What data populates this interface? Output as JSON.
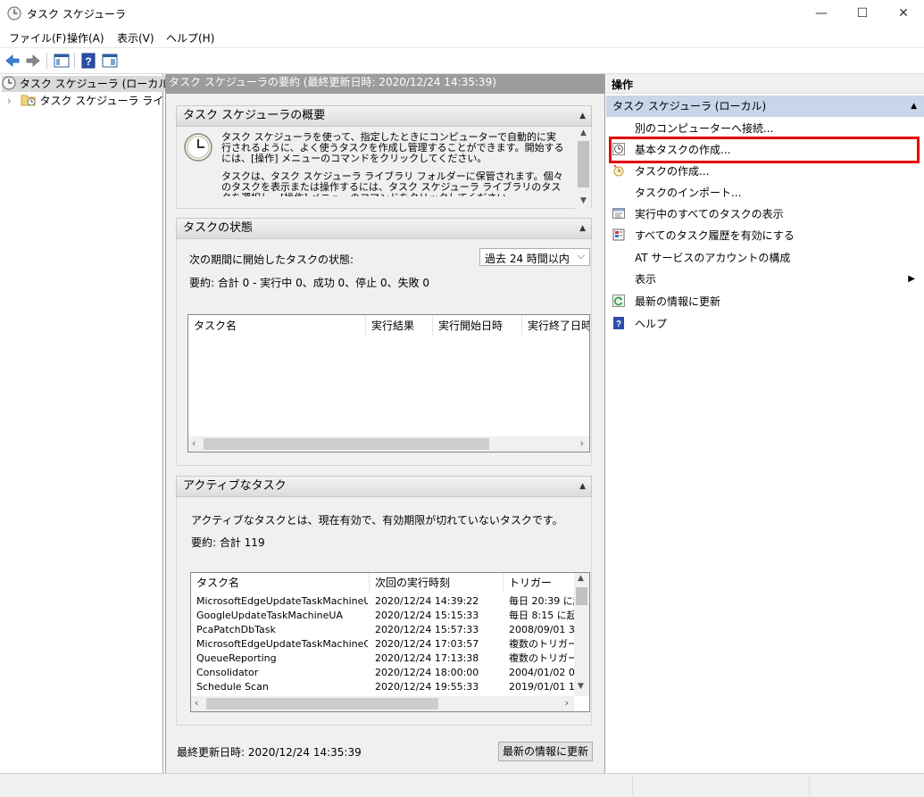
{
  "window": {
    "title": "タスク スケジューラ",
    "min_glyph": "—",
    "max_glyph": "☐",
    "close_glyph": "✕"
  },
  "menu": [
    "ファイル(F)",
    "操作(A)",
    "表示(V)",
    "ヘルプ(H)"
  ],
  "tree": {
    "root": "タスク スケジューラ (ローカル)",
    "child": "タスク スケジューラ ライブラリ",
    "expander": "›"
  },
  "center": {
    "header": "タスク スケジューラの要約 (最終更新日時: 2020/12/24 14:35:39)",
    "overview": {
      "title": "タスク スケジューラの概要",
      "p1": "タスク スケジューラを使って、指定したときにコンピューターで自動的に実行されるように、よく使うタスクを作成し管理することができます。開始するには、[操作] メニューのコマンドをクリックしてください。",
      "p2": "タスクは、タスク スケジューラ ライブラリ フォルダーに保管されます。個々のタスクを表示または操作するには、タスク スケジューラ ライブラリのタスクを選択し、[操作] メニューのコマンドをクリックしてください。"
    },
    "status": {
      "title": "タスクの状態",
      "period_label": "次の期間に開始したタスクの状態:",
      "period_value": "過去 24 時間以内",
      "summary": "要約: 合計 0 - 実行中 0、成功 0、停止 0、失敗 0",
      "columns": [
        "タスク名",
        "実行結果",
        "実行開始日時",
        "実行終了日時"
      ]
    },
    "active": {
      "title": "アクティブなタスク",
      "description": "アクティブなタスクとは、現在有効で、有効期限が切れていないタスクです。",
      "summary": "要約: 合計 119",
      "columns": [
        "タスク名",
        "次回の実行時刻",
        "トリガー"
      ],
      "rows": [
        [
          "MicrosoftEdgeUpdateTaskMachineUA",
          "2020/12/24 14:39:22",
          "毎日 20:39 に起"
        ],
        [
          "GoogleUpdateTaskMachineUA",
          "2020/12/24 15:15:33",
          "毎日 8:15 に起"
        ],
        [
          "PcaPatchDbTask",
          "2020/12/24 15:57:33",
          "2008/09/01 3"
        ],
        [
          "MicrosoftEdgeUpdateTaskMachineC...",
          "2020/12/24 17:03:57",
          "複数のトリガーが"
        ],
        [
          "QueueReporting",
          "2020/12/24 17:13:38",
          "複数のトリガーが"
        ],
        [
          "Consolidator",
          "2020/12/24 18:00:00",
          "2004/01/02 0"
        ],
        [
          "Schedule Scan",
          "2020/12/24 19:55:33",
          "2019/01/01 1"
        ]
      ]
    },
    "footer": {
      "last_updated": "最終更新日時: 2020/12/24 14:35:39",
      "refresh_button": "最新の情報に更新"
    }
  },
  "actions": {
    "header": "操作",
    "group": "タスク スケジューラ (ローカル)",
    "items": [
      "別のコンピューターへ接続...",
      "基本タスクの作成...",
      "タスクの作成...",
      "タスクのインポート...",
      "実行中のすべてのタスクの表示",
      "すべてのタスク履歴を有効にする",
      "AT サービスのアカウントの構成",
      "表示",
      "最新の情報に更新",
      "ヘルプ"
    ]
  },
  "colors": {
    "highlight": "#e60000",
    "group_bg": "#c7d6e8",
    "header_gray": "#9c9c9c"
  }
}
